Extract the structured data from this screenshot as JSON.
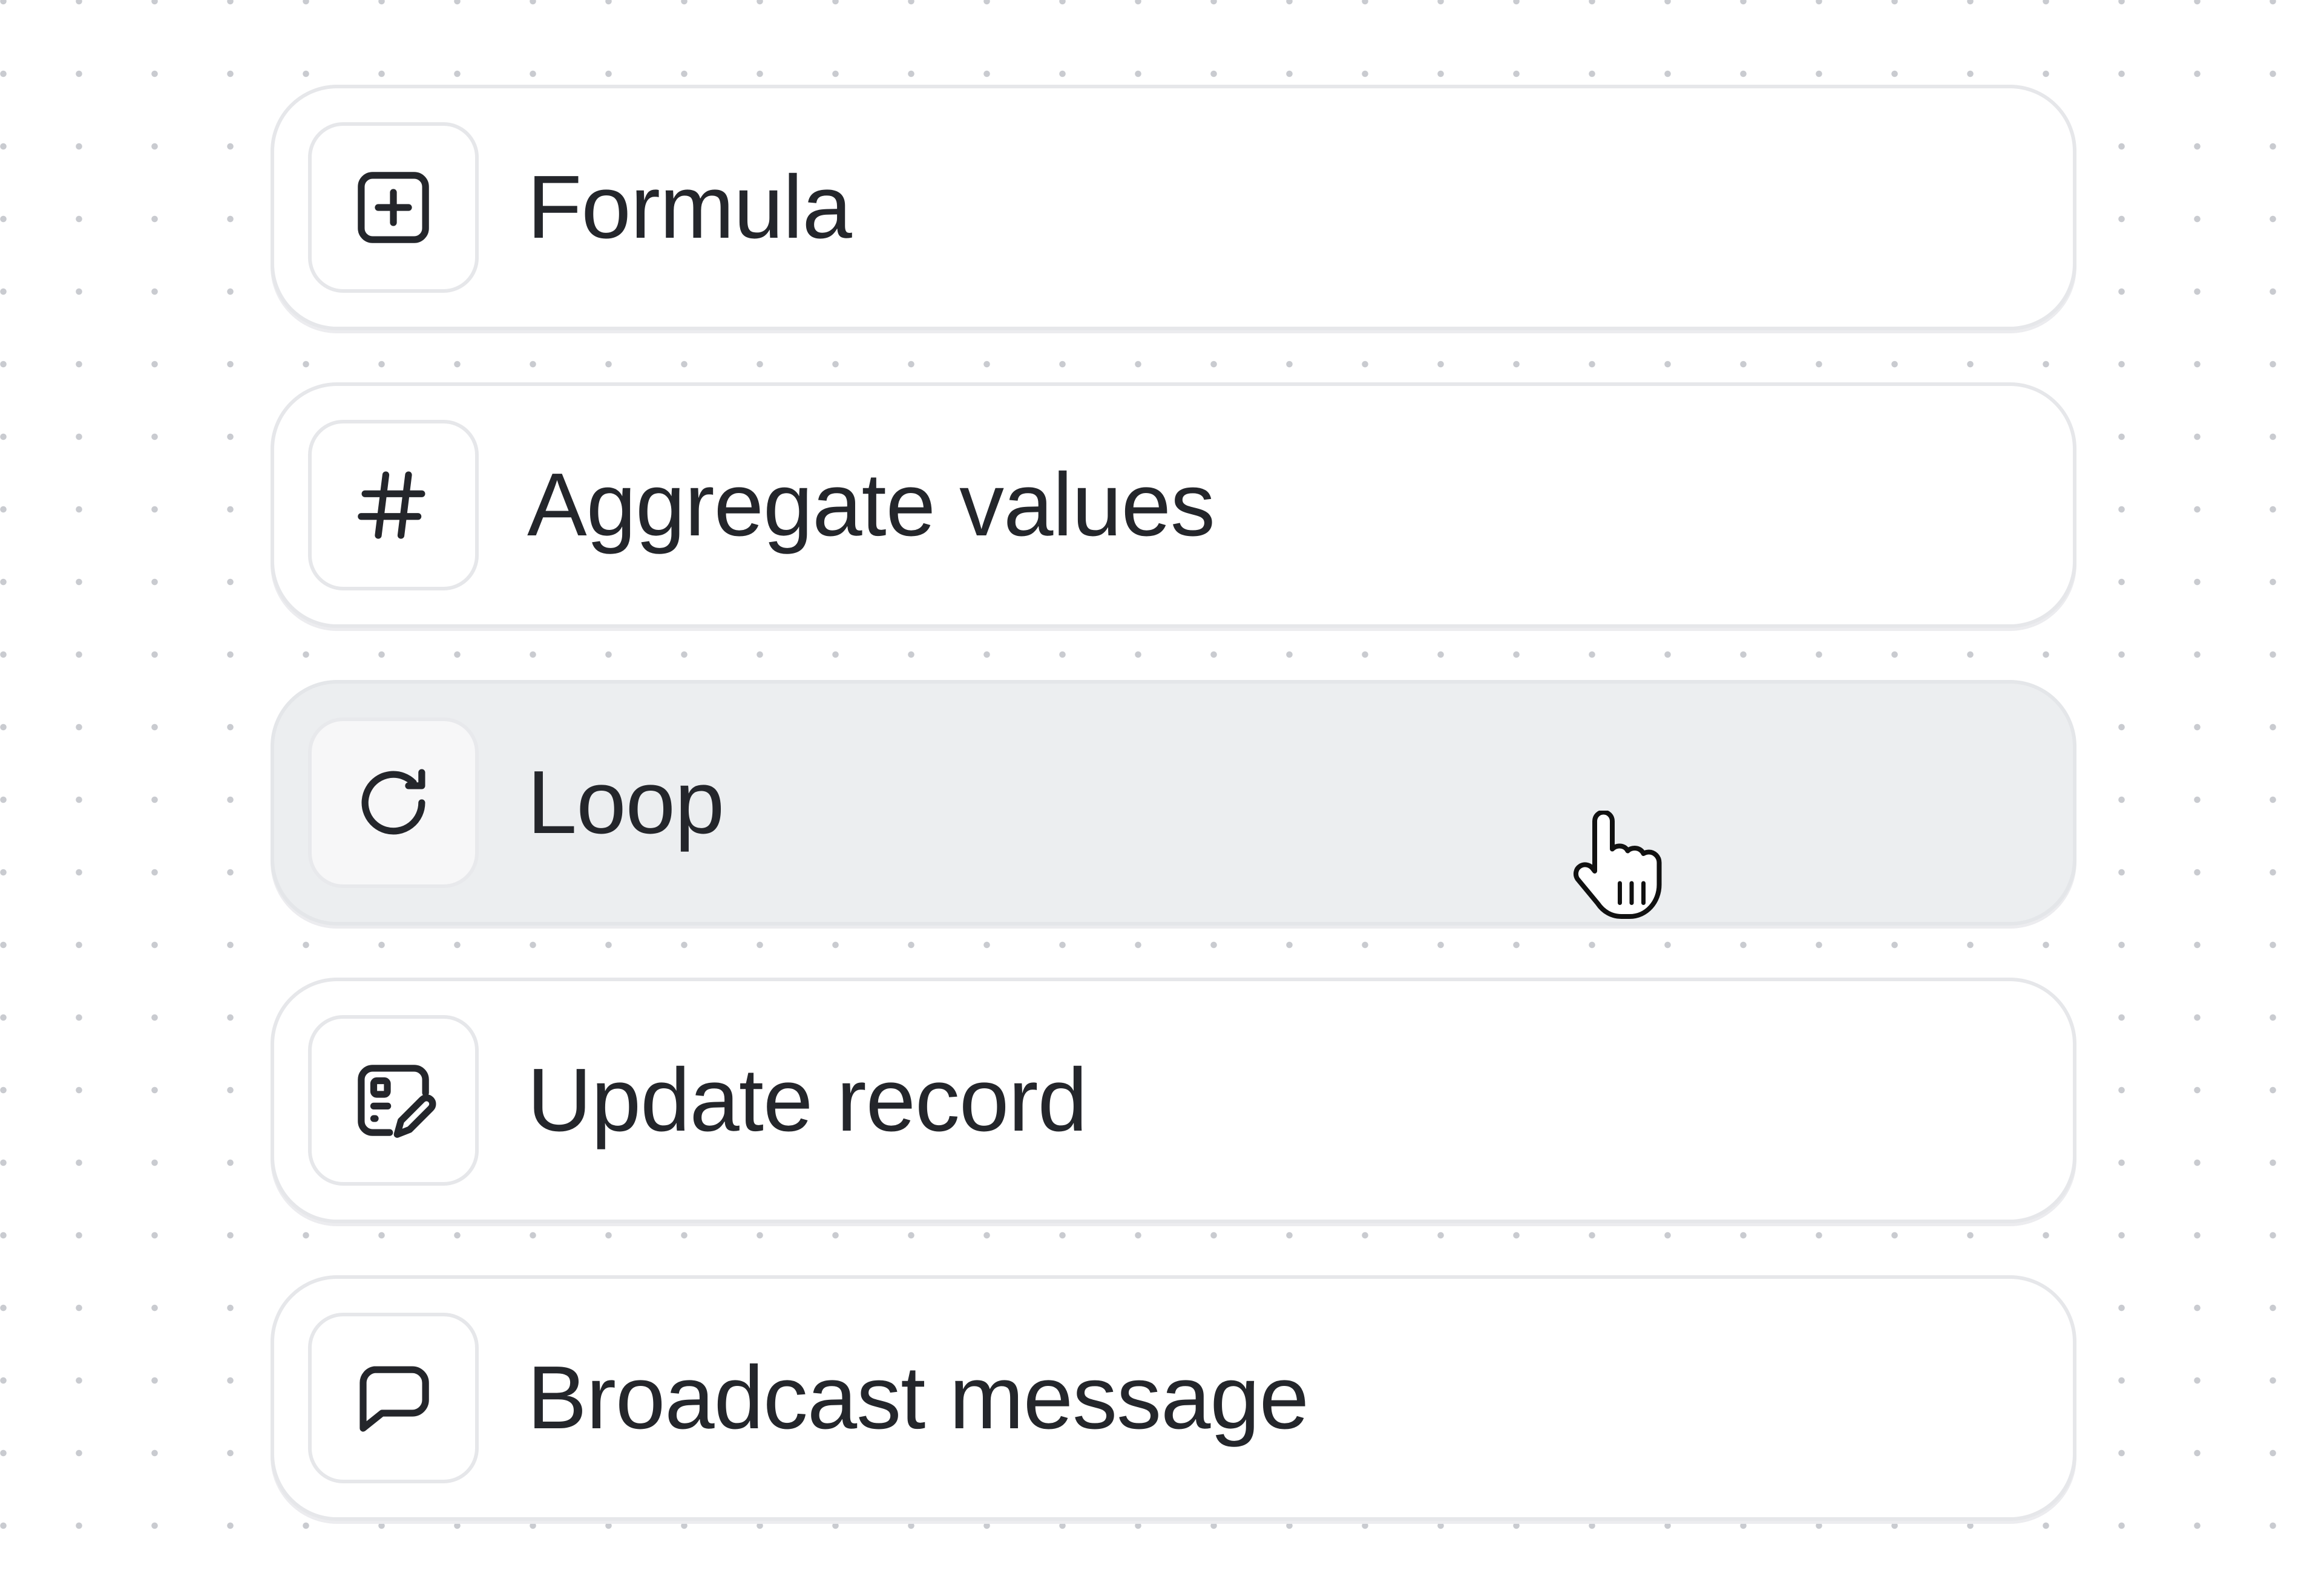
{
  "menu": {
    "items": [
      {
        "label": "Formula",
        "icon": "plus-square-icon"
      },
      {
        "label": "Aggregate values",
        "icon": "hash-icon"
      },
      {
        "label": "Loop",
        "icon": "refresh-icon",
        "state": "hovered"
      },
      {
        "label": "Update record",
        "icon": "record-edit-icon"
      },
      {
        "label": "Broadcast message",
        "icon": "chat-bubble-icon"
      }
    ]
  },
  "colors": {
    "text": "#24262b",
    "border": "#e6e7ea",
    "hover_background": "#eceef0",
    "dot_grid": "#c9cbd0"
  },
  "cursor": {
    "icon": "hand-pointer-icon"
  }
}
